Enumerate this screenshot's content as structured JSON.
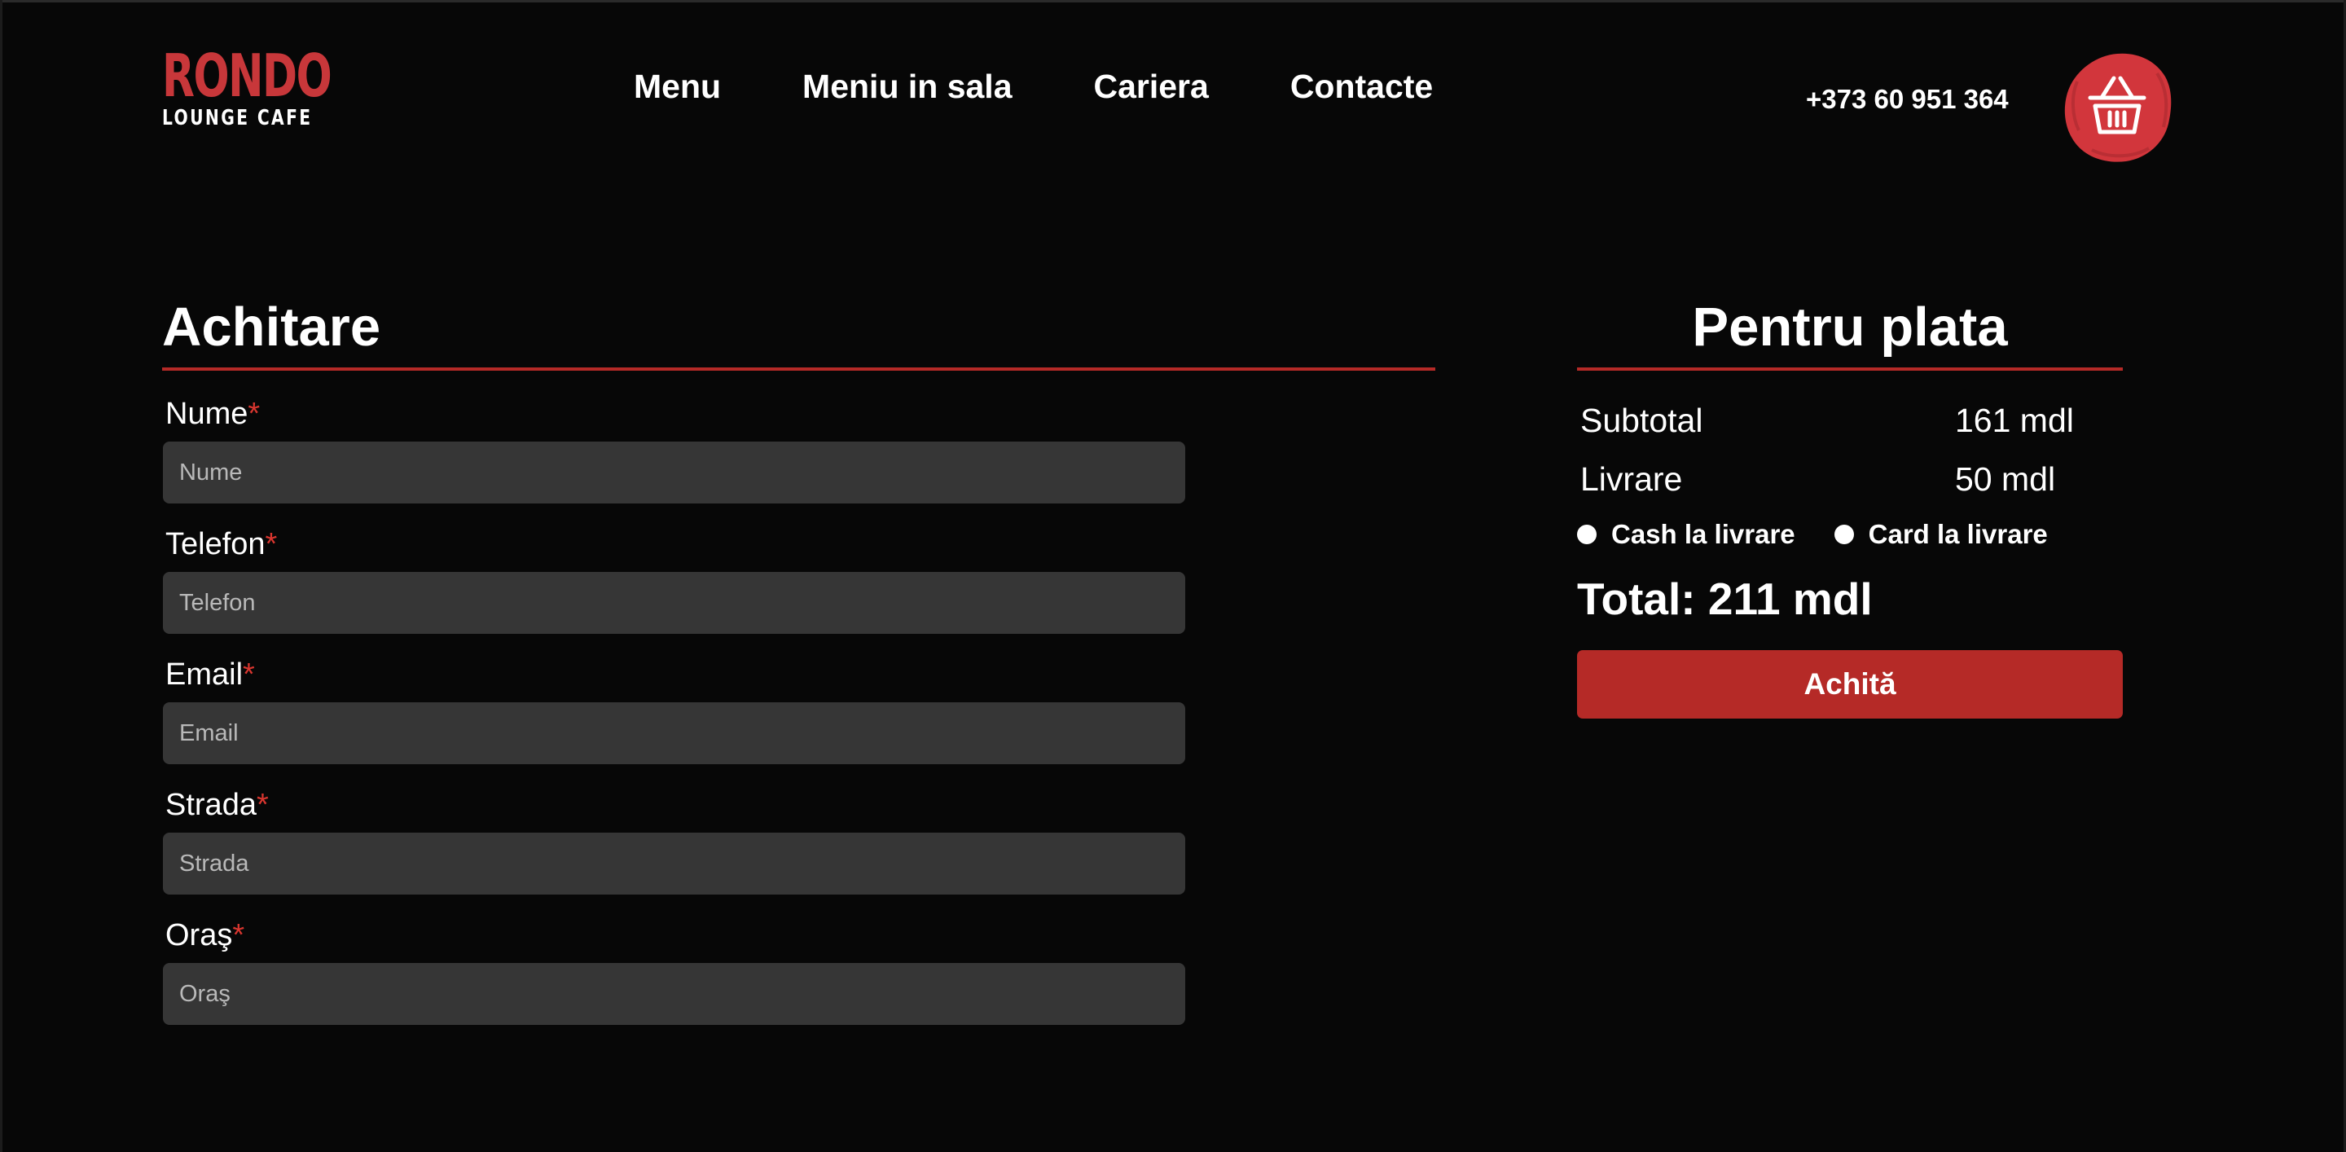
{
  "brand": {
    "name": "RONDO",
    "tagline": "LOUNGE CAFE",
    "accent_color": "#c8373a"
  },
  "nav": {
    "items": [
      "Menu",
      "Meniu in sala",
      "Cariera",
      "Contacte"
    ]
  },
  "header": {
    "phone": "+373 60 951 364",
    "cart_icon": "basket-icon"
  },
  "checkout": {
    "title": "Achitare",
    "fields": [
      {
        "label": "Nume",
        "required_mark": "*",
        "placeholder": "Nume"
      },
      {
        "label": "Telefon",
        "required_mark": "*",
        "placeholder": "Telefon"
      },
      {
        "label": "Email",
        "required_mark": "*",
        "placeholder": "Email"
      },
      {
        "label": "Strada",
        "required_mark": "*",
        "placeholder": "Strada"
      },
      {
        "label": "Oraş",
        "required_mark": "*",
        "placeholder": "Oraş"
      }
    ]
  },
  "summary": {
    "title": "Pentru plata",
    "subtotal_label": "Subtotal",
    "subtotal_value": "161 mdl",
    "delivery_label": "Livrare",
    "delivery_value": "50 mdl",
    "payment_options": [
      "Cash la livrare",
      "Card la livrare"
    ],
    "total": "Total: 211 mdl",
    "pay_button": "Achită"
  }
}
